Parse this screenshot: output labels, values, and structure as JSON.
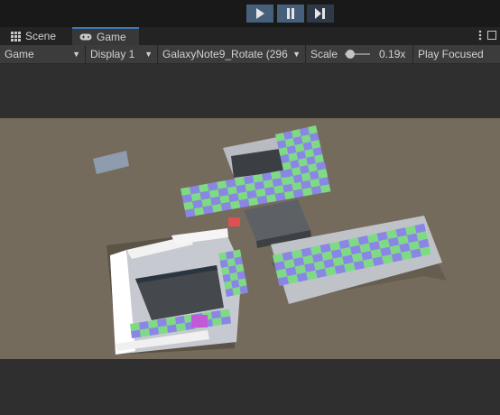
{
  "play_controls": {
    "play_icon": "play-icon",
    "pause_icon": "pause-icon",
    "step_icon": "step-icon",
    "active_color": "#46607c"
  },
  "tabs": [
    {
      "label": "Scene",
      "icon": "grid-icon"
    },
    {
      "label": "Game",
      "icon": "gamepad-icon"
    }
  ],
  "toolbar": {
    "view_mode": "Game",
    "display": "Display 1",
    "resolution": "GalaxyNote9_Rotate (296",
    "scale_label": "Scale",
    "scale_value": "0.19x",
    "scale_fraction": 0.05,
    "play_mode": "Play Focused"
  },
  "scene": {
    "background": "#756b5c",
    "checker_green": "#7fda85",
    "checker_blue": "#8a86e6",
    "highlight_red": "#e05050",
    "highlight_purple": "#c25ad8"
  }
}
